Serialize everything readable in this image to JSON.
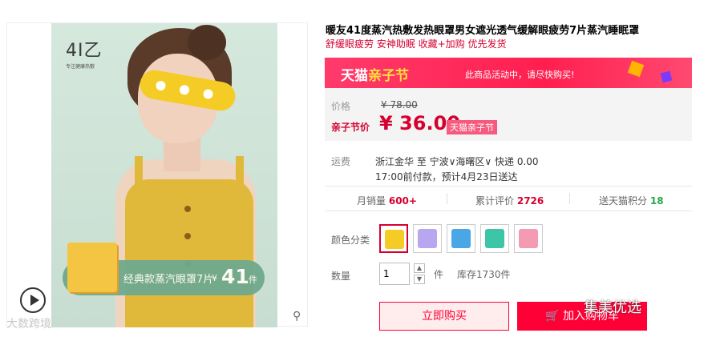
{
  "gallery": {
    "brand_logo": "4I乙",
    "brand_sub": "专注健康热敷",
    "promo_text": "经典款蒸汽眼罩7片",
    "promo_yen": "¥",
    "promo_num": "41",
    "promo_unit": "件"
  },
  "product": {
    "title": "暖友41度蒸汽热敷发热眼罩男女遮光透气缓解眼疲劳7片蒸汽睡眠罩",
    "subtitle": "舒缓眼疲劳 安神助眠 收藏+加购 优先发货"
  },
  "banner": {
    "logo_a": "天猫",
    "logo_b": "亲子节",
    "message": "此商品活动中，请尽快购买!"
  },
  "price": {
    "label_price": "价格",
    "original": "¥ 78.00",
    "label_promo": "亲子节价",
    "current": "¥ 36.00",
    "tag": "天猫亲子节"
  },
  "shipping": {
    "label": "运费",
    "line1": "浙江金华  至  宁波∨海曙区∨  快递  0.00",
    "line2": "17:00前付款，预计4月23日送达"
  },
  "stats": {
    "monthly_label": "月销量",
    "monthly_value": "600+",
    "reviews_label": "累计评价",
    "reviews_value": "2726",
    "points_label": "送天猫积分",
    "points_value": "18"
  },
  "options": {
    "color_label": "颜色分类",
    "swatches": [
      {
        "color": "#f5cc26",
        "name": "yellow"
      },
      {
        "color": "#b9a6f0",
        "name": "purple"
      },
      {
        "color": "#4aa7e6",
        "name": "blue"
      },
      {
        "color": "#3dc5a8",
        "name": "teal"
      },
      {
        "color": "#f59ab3",
        "name": "pink"
      }
    ],
    "qty_label": "数量",
    "qty_value": "1",
    "qty_unit": "件",
    "stock": "库存1730件"
  },
  "actions": {
    "buy_now": "立即购买",
    "add_cart": "加入购物车"
  },
  "watermarks": {
    "left": "大数跨境",
    "right": "集美优选"
  }
}
